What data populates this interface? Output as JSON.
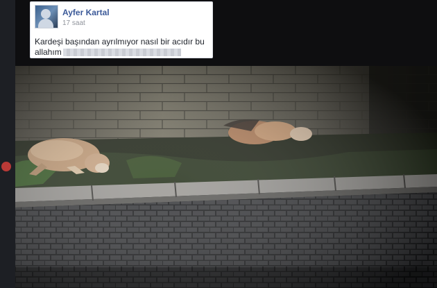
{
  "post": {
    "author": "Ayfer Kartal",
    "timestamp": "17 saat",
    "text_line1": "Kardeşi başından ayrılmıyor nasıl bir acıdır bu",
    "text_line2": "allahım"
  },
  "icons": {
    "avatar": "profile-avatar",
    "redacted": "blurred-text"
  },
  "colors": {
    "author_link": "#3b5998",
    "timestamp": "#90949c",
    "body_text": "#1d2129"
  }
}
